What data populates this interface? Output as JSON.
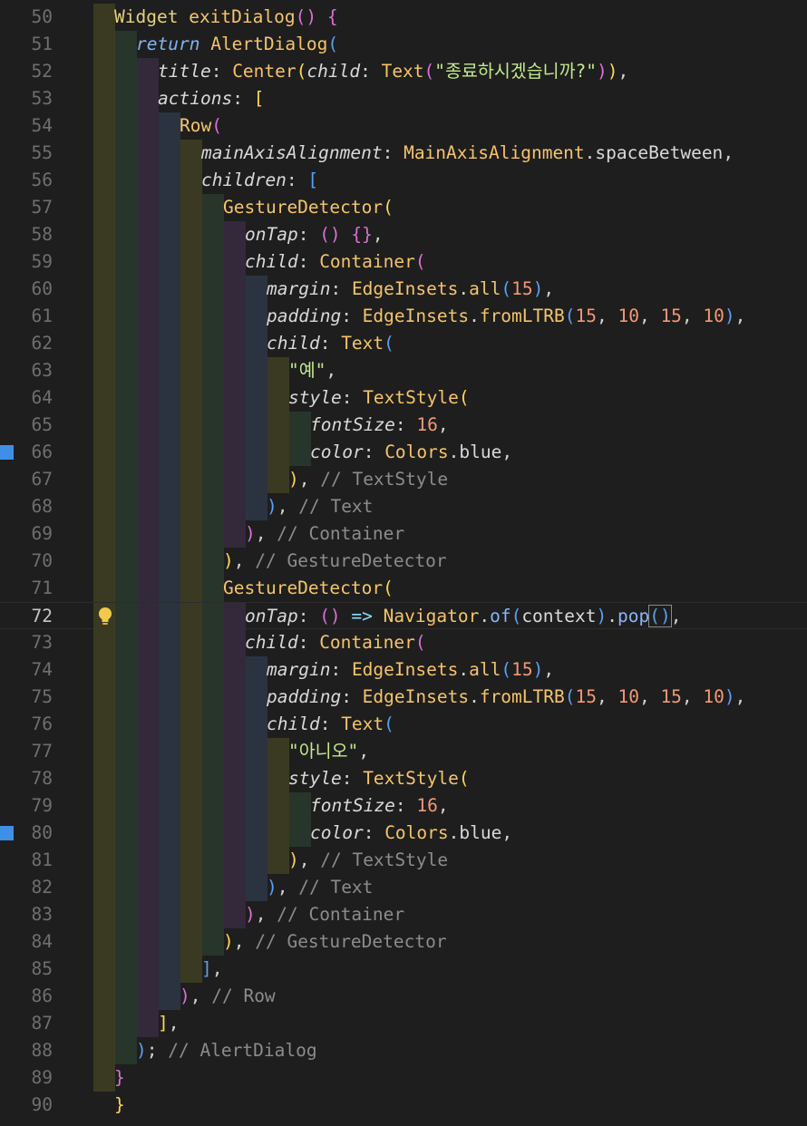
{
  "editor": {
    "lines": [
      {
        "num": "50",
        "tokens": [
          [
            "k",
            "Widget"
          ],
          [
            "p",
            " "
          ],
          [
            "f",
            "exitDialog"
          ],
          [
            "pp",
            "()"
          ],
          [
            "p",
            " "
          ],
          [
            "pp",
            "{"
          ]
        ]
      },
      {
        "num": "51",
        "tokens": [
          [
            "kw",
            "return"
          ],
          [
            "p",
            " "
          ],
          [
            "f",
            "AlertDialog"
          ],
          [
            "pc",
            "("
          ]
        ]
      },
      {
        "num": "52",
        "tokens": [
          [
            "ni",
            "title"
          ],
          [
            "p",
            ": "
          ],
          [
            "f",
            "Center"
          ],
          [
            "pb",
            "("
          ],
          [
            "ni",
            "child"
          ],
          [
            "p",
            ": "
          ],
          [
            "f",
            "Text"
          ],
          [
            "pp",
            "("
          ],
          [
            "s",
            "\"종료하시겠습니까?\""
          ],
          [
            "pp",
            ")"
          ],
          [
            "pb",
            ")"
          ],
          [
            "p",
            ","
          ]
        ]
      },
      {
        "num": "53",
        "tokens": [
          [
            "ni",
            "actions"
          ],
          [
            "p",
            ": "
          ],
          [
            "pb",
            "["
          ]
        ]
      },
      {
        "num": "54",
        "tokens": [
          [
            "f",
            "Row"
          ],
          [
            "pp",
            "("
          ]
        ]
      },
      {
        "num": "55",
        "tokens": [
          [
            "ni",
            "mainAxisAlignment"
          ],
          [
            "p",
            ": "
          ],
          [
            "f",
            "MainAxisAlignment"
          ],
          [
            "p",
            "."
          ],
          [
            "n",
            "spaceBetween"
          ],
          [
            "p",
            ","
          ]
        ]
      },
      {
        "num": "56",
        "tokens": [
          [
            "ni",
            "children"
          ],
          [
            "p",
            ": "
          ],
          [
            "pc",
            "["
          ]
        ]
      },
      {
        "num": "57",
        "tokens": [
          [
            "f",
            "GestureDetector"
          ],
          [
            "pb",
            "("
          ]
        ]
      },
      {
        "num": "58",
        "tokens": [
          [
            "ni",
            "onTap"
          ],
          [
            "p",
            ": "
          ],
          [
            "pp",
            "()"
          ],
          [
            "p",
            " "
          ],
          [
            "pp",
            "{}"
          ],
          [
            "p",
            ","
          ]
        ]
      },
      {
        "num": "59",
        "tokens": [
          [
            "ni",
            "child"
          ],
          [
            "p",
            ": "
          ],
          [
            "f",
            "Container"
          ],
          [
            "pp",
            "("
          ]
        ]
      },
      {
        "num": "60",
        "tokens": [
          [
            "ni",
            "margin"
          ],
          [
            "p",
            ": "
          ],
          [
            "f",
            "EdgeInsets"
          ],
          [
            "p",
            "."
          ],
          [
            "f",
            "all"
          ],
          [
            "pc",
            "("
          ],
          [
            "num",
            "15"
          ],
          [
            "pc",
            ")"
          ],
          [
            "p",
            ","
          ]
        ]
      },
      {
        "num": "61",
        "tokens": [
          [
            "ni",
            "padding"
          ],
          [
            "p",
            ": "
          ],
          [
            "f",
            "EdgeInsets"
          ],
          [
            "p",
            "."
          ],
          [
            "f",
            "fromLTRB"
          ],
          [
            "pc",
            "("
          ],
          [
            "num",
            "15"
          ],
          [
            "p",
            ", "
          ],
          [
            "num",
            "10"
          ],
          [
            "p",
            ", "
          ],
          [
            "num",
            "15"
          ],
          [
            "p",
            ", "
          ],
          [
            "num",
            "10"
          ],
          [
            "pc",
            ")"
          ],
          [
            "p",
            ","
          ]
        ]
      },
      {
        "num": "62",
        "tokens": [
          [
            "ni",
            "child"
          ],
          [
            "p",
            ": "
          ],
          [
            "f",
            "Text"
          ],
          [
            "pc",
            "("
          ]
        ]
      },
      {
        "num": "63",
        "tokens": [
          [
            "s",
            "\"예\""
          ],
          [
            "p",
            ","
          ]
        ]
      },
      {
        "num": "64",
        "tokens": [
          [
            "ni",
            "style"
          ],
          [
            "p",
            ": "
          ],
          [
            "f",
            "TextStyle"
          ],
          [
            "pb",
            "("
          ]
        ]
      },
      {
        "num": "65",
        "tokens": [
          [
            "ni",
            "fontSize"
          ],
          [
            "p",
            ": "
          ],
          [
            "num",
            "16"
          ],
          [
            "p",
            ","
          ]
        ]
      },
      {
        "num": "66",
        "tokens": [
          [
            "ni",
            "color"
          ],
          [
            "p",
            ": "
          ],
          [
            "f",
            "Colors"
          ],
          [
            "p",
            "."
          ],
          [
            "n",
            "blue"
          ],
          [
            "p",
            ","
          ]
        ]
      },
      {
        "num": "67",
        "tokens": [
          [
            "pb",
            ")"
          ],
          [
            "p",
            ", "
          ],
          [
            "c",
            "// TextStyle"
          ]
        ]
      },
      {
        "num": "68",
        "tokens": [
          [
            "pc",
            ")"
          ],
          [
            "p",
            ", "
          ],
          [
            "c",
            "// Text"
          ]
        ]
      },
      {
        "num": "69",
        "tokens": [
          [
            "pp",
            ")"
          ],
          [
            "p",
            ", "
          ],
          [
            "c",
            "// Container"
          ]
        ]
      },
      {
        "num": "70",
        "tokens": [
          [
            "pb",
            ")"
          ],
          [
            "p",
            ", "
          ],
          [
            "c",
            "// GestureDetector"
          ]
        ]
      },
      {
        "num": "71",
        "tokens": [
          [
            "f",
            "GestureDetector"
          ],
          [
            "pb",
            "("
          ]
        ]
      },
      {
        "num": "72",
        "tokens": [
          [
            "ni",
            "onTap"
          ],
          [
            "p",
            ": "
          ],
          [
            "pp",
            "()"
          ],
          [
            "p",
            " "
          ],
          [
            "op",
            "=>"
          ],
          [
            "p",
            " "
          ],
          [
            "f",
            "Navigator"
          ],
          [
            "p",
            "."
          ],
          [
            "pu",
            "of"
          ],
          [
            "pc",
            "("
          ],
          [
            "n",
            "context"
          ],
          [
            "pc",
            ")"
          ],
          [
            "p",
            "."
          ],
          [
            "pu",
            "pop"
          ],
          [
            "pc",
            "()"
          ],
          [
            "p",
            ","
          ]
        ]
      },
      {
        "num": "73",
        "tokens": [
          [
            "ni",
            "child"
          ],
          [
            "p",
            ": "
          ],
          [
            "f",
            "Container"
          ],
          [
            "pp",
            "("
          ]
        ]
      },
      {
        "num": "74",
        "tokens": [
          [
            "ni",
            "margin"
          ],
          [
            "p",
            ": "
          ],
          [
            "f",
            "EdgeInsets"
          ],
          [
            "p",
            "."
          ],
          [
            "f",
            "all"
          ],
          [
            "pc",
            "("
          ],
          [
            "num",
            "15"
          ],
          [
            "pc",
            ")"
          ],
          [
            "p",
            ","
          ]
        ]
      },
      {
        "num": "75",
        "tokens": [
          [
            "ni",
            "padding"
          ],
          [
            "p",
            ": "
          ],
          [
            "f",
            "EdgeInsets"
          ],
          [
            "p",
            "."
          ],
          [
            "f",
            "fromLTRB"
          ],
          [
            "pc",
            "("
          ],
          [
            "num",
            "15"
          ],
          [
            "p",
            ", "
          ],
          [
            "num",
            "10"
          ],
          [
            "p",
            ", "
          ],
          [
            "num",
            "15"
          ],
          [
            "p",
            ", "
          ],
          [
            "num",
            "10"
          ],
          [
            "pc",
            ")"
          ],
          [
            "p",
            ","
          ]
        ]
      },
      {
        "num": "76",
        "tokens": [
          [
            "ni",
            "child"
          ],
          [
            "p",
            ": "
          ],
          [
            "f",
            "Text"
          ],
          [
            "pc",
            "("
          ]
        ]
      },
      {
        "num": "77",
        "tokens": [
          [
            "s",
            "\"아니오\""
          ],
          [
            "p",
            ","
          ]
        ]
      },
      {
        "num": "78",
        "tokens": [
          [
            "ni",
            "style"
          ],
          [
            "p",
            ": "
          ],
          [
            "f",
            "TextStyle"
          ],
          [
            "pb",
            "("
          ]
        ]
      },
      {
        "num": "79",
        "tokens": [
          [
            "ni",
            "fontSize"
          ],
          [
            "p",
            ": "
          ],
          [
            "num",
            "16"
          ],
          [
            "p",
            ","
          ]
        ]
      },
      {
        "num": "80",
        "tokens": [
          [
            "ni",
            "color"
          ],
          [
            "p",
            ": "
          ],
          [
            "f",
            "Colors"
          ],
          [
            "p",
            "."
          ],
          [
            "n",
            "blue"
          ],
          [
            "p",
            ","
          ]
        ]
      },
      {
        "num": "81",
        "tokens": [
          [
            "pb",
            ")"
          ],
          [
            "p",
            ", "
          ],
          [
            "c",
            "// TextStyle"
          ]
        ]
      },
      {
        "num": "82",
        "tokens": [
          [
            "pc",
            ")"
          ],
          [
            "p",
            ", "
          ],
          [
            "c",
            "// Text"
          ]
        ]
      },
      {
        "num": "83",
        "tokens": [
          [
            "pp",
            ")"
          ],
          [
            "p",
            ", "
          ],
          [
            "c",
            "// Container"
          ]
        ]
      },
      {
        "num": "84",
        "tokens": [
          [
            "pb",
            ")"
          ],
          [
            "p",
            ", "
          ],
          [
            "c",
            "// GestureDetector"
          ]
        ]
      },
      {
        "num": "85",
        "tokens": [
          [
            "pc",
            "]"
          ],
          [
            "p",
            ","
          ]
        ]
      },
      {
        "num": "86",
        "tokens": [
          [
            "pp",
            ")"
          ],
          [
            "p",
            ", "
          ],
          [
            "c",
            "// Row"
          ]
        ]
      },
      {
        "num": "87",
        "tokens": [
          [
            "pb",
            "]"
          ],
          [
            "p",
            ","
          ]
        ]
      },
      {
        "num": "88",
        "tokens": [
          [
            "pc",
            ")"
          ],
          [
            "p",
            "; "
          ],
          [
            "c",
            "// AlertDialog"
          ]
        ]
      },
      {
        "num": "89",
        "tokens": [
          [
            "pp",
            "}"
          ]
        ]
      },
      {
        "num": "90",
        "tokens": [
          [
            "pb",
            "}"
          ]
        ]
      }
    ],
    "current_line": "72",
    "lightbulb_icon": "lightbulb-icon",
    "modified_lines": [
      "66",
      "80"
    ],
    "colors": {
      "background": "#1e1e1e",
      "indent_guides": [
        "#3a3a22",
        "#28352b",
        "#33293b",
        "#2b3340"
      ]
    }
  }
}
